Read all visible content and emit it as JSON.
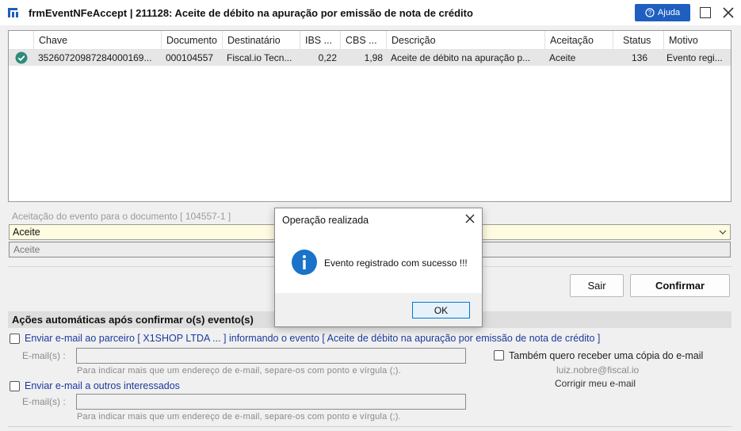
{
  "window": {
    "title": "frmEventNFeAccept | 211128: Aceite de débito na apuração por emissão de nota de crédito",
    "help_label": "Ajuda"
  },
  "grid": {
    "columns": [
      "Chave",
      "Documento",
      "Destinatário",
      "IBS ...",
      "CBS ...",
      "Descrição",
      "Aceitação",
      "Status",
      "Motivo"
    ],
    "rows": [
      {
        "status_icon": "check-circle-icon",
        "chave": "35260720987284000169...",
        "documento": "000104557",
        "destinatario": "Fiscal.io Tecn...",
        "ibs": "0,22",
        "cbs": "1,98",
        "descricao": "Aceite de débito na apuração p...",
        "aceitacao": "Aceite",
        "status": "136",
        "motivo": "Evento regi..."
      }
    ]
  },
  "acceptance": {
    "label": "Aceitação do evento para o documento [ 104557-1 ]",
    "selected": "Aceite",
    "description": "Aceite"
  },
  "buttons": {
    "exit": "Sair",
    "confirm": "Confirmar"
  },
  "auto_actions": {
    "header": "Ações automáticas após confirmar o(s) evento(s)",
    "option1_label": "Enviar e-mail ao parceiro [ X1SHOP LTDA ... ] informando o evento [ Aceite de débito na apuração por emissão de nota de crédito ]",
    "option1_checked": false,
    "emails_label": "E-mail(s) :",
    "emails_value1": "",
    "hint1": "Para indicar mais que um endereço de e-mail, separe-os com ponto e vírgula (;).",
    "copy_label": "Também quero receber uma cópia do e-mail",
    "copy_checked": false,
    "user_email": "luiz.nobre@fiscal.io",
    "fix_email": "Corrigir meu e-mail",
    "option2_label": "Enviar e-mail a outros interessados",
    "option2_checked": false,
    "emails_label2": "E-mail(s) :",
    "emails_value2": "",
    "hint2": "Para indicar mais que um endereço de e-mail, separe-os com ponto e vírgula (;)."
  },
  "dialog": {
    "title": "Operação realizada",
    "message": "Evento registrado com sucesso !!!",
    "ok_label": "OK",
    "icon": "info-icon"
  },
  "colors": {
    "accent": "#1f5fbf",
    "success": "#2e8b79",
    "info": "#1a73c9",
    "select_bg": "#fffbe0"
  }
}
